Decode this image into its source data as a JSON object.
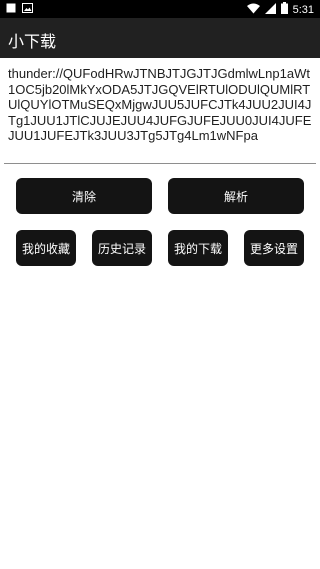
{
  "status_bar": {
    "time": "5:31",
    "left_icons": [
      "notification-square-icon",
      "image-icon"
    ],
    "right_icons": [
      "wifi-icon",
      "signal-icon",
      "battery-icon"
    ]
  },
  "toolbar": {
    "title": "小下载",
    "background": "#212121"
  },
  "input": {
    "value": "thunder://QUFodHRwJTNBJTJGJTJGdmlwLnp1aWt1OC5jb20lMkYxODA5JTJGQVElRTUlODUlQUMlRTUlQUYlOTMuSEQxMjgwJUU5JUFCJTk4JUU2JUI4JTg1JUU1JTlCJUJEJUU4JUFGJUFEJUU0JUI4JUFEJUU1JUFEJTk3JUU3JTg5JTg4Lm1wNFpa"
  },
  "buttons": {
    "clear": "清除",
    "parse": "解析",
    "favorites": "我的收藏",
    "history": "历史记录",
    "downloads": "我的下载",
    "settings": "更多设置"
  },
  "colors": {
    "button_bg": "#141414",
    "status_bar_bg": "#000000"
  }
}
